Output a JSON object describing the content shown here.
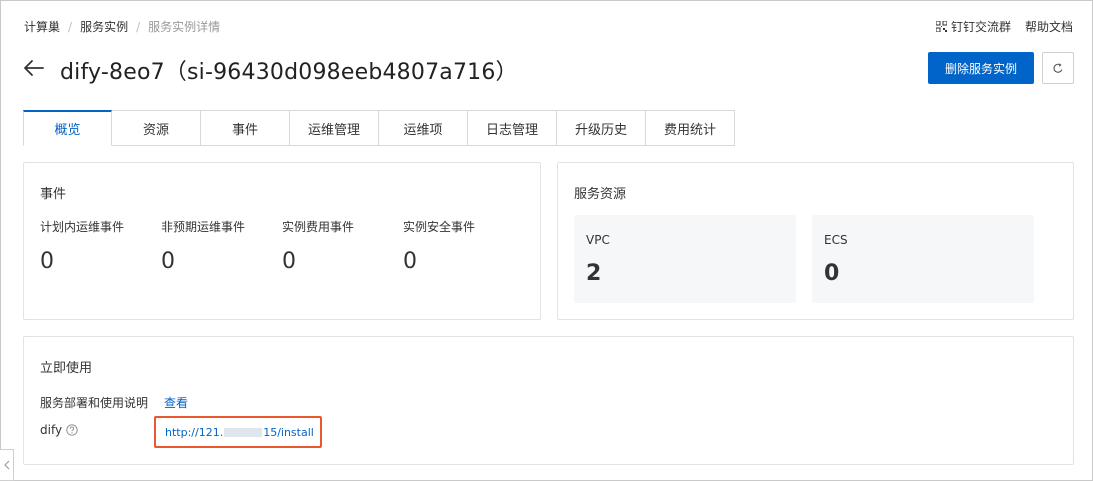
{
  "breadcrumb": [
    "计算巢",
    "服务实例",
    "服务实例详情"
  ],
  "top_links": {
    "dingtalk": "钉钉交流群",
    "help": "帮助文档"
  },
  "title": "dify-8eo7（si-96430d098eeb4807a716）",
  "actions": {
    "delete": "删除服务实例"
  },
  "tabs": [
    "概览",
    "资源",
    "事件",
    "运维管理",
    "运维项",
    "日志管理",
    "升级历史",
    "费用统计"
  ],
  "events": {
    "title": "事件",
    "items": [
      {
        "label": "计划内运维事件",
        "value": "0"
      },
      {
        "label": "非预期运维事件",
        "value": "0"
      },
      {
        "label": "实例费用事件",
        "value": "0"
      },
      {
        "label": "实例安全事件",
        "value": "0"
      }
    ]
  },
  "resources": {
    "title": "服务资源",
    "items": [
      {
        "label": "VPC",
        "value": "2"
      },
      {
        "label": "ECS",
        "value": "0"
      }
    ]
  },
  "usage": {
    "title": "立即使用",
    "instructions_label": "服务部署和使用说明",
    "view_link": "查看",
    "app_label": "dify",
    "url_prefix": "http://121.",
    "url_suffix": "15/install"
  },
  "colors": {
    "primary": "#0064c8",
    "highlight_border": "#e9582f"
  }
}
